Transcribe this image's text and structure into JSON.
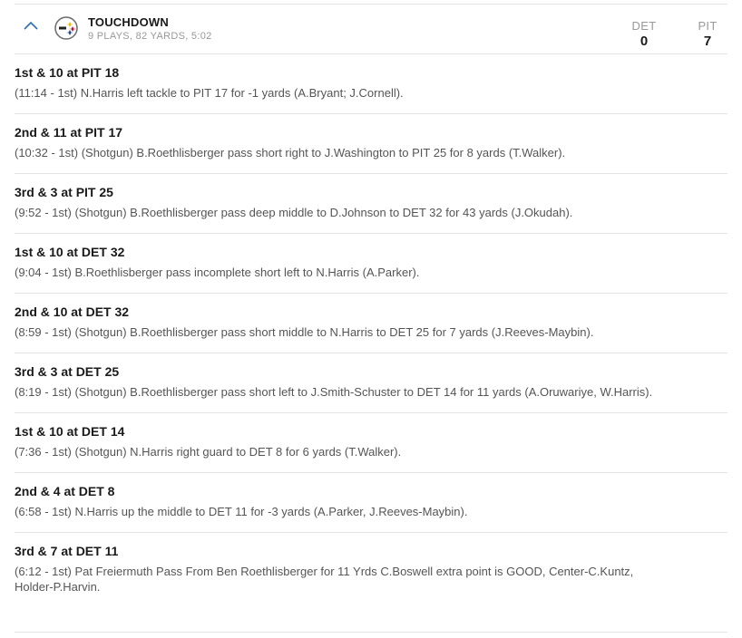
{
  "drive": {
    "result": "TOUCHDOWN",
    "summary": "9 PLAYS, 82 YARDS, 5:02",
    "scores": [
      {
        "team": "DET",
        "score": "0"
      },
      {
        "team": "PIT",
        "score": "7"
      }
    ],
    "colors": {
      "accent": "#2a6fb0",
      "logo_yellow": "#f5b400",
      "logo_red": "#c8102e",
      "logo_blue": "#1f3c88"
    }
  },
  "plays": [
    {
      "title": "1st & 10 at PIT 18",
      "desc": "(11:14 - 1st) N.Harris left tackle to PIT 17 for -1 yards (A.Bryant; J.Cornell)."
    },
    {
      "title": "2nd & 11 at PIT 17",
      "desc": "(10:32 - 1st) (Shotgun) B.Roethlisberger pass short right to J.Washington to PIT 25 for 8 yards (T.Walker)."
    },
    {
      "title": "3rd & 3 at PIT 25",
      "desc": "(9:52 - 1st) (Shotgun) B.Roethlisberger pass deep middle to D.Johnson to DET 32 for 43 yards (J.Okudah)."
    },
    {
      "title": "1st & 10 at DET 32",
      "desc": "(9:04 - 1st) B.Roethlisberger pass incomplete short left to N.Harris (A.Parker)."
    },
    {
      "title": "2nd & 10 at DET 32",
      "desc": "(8:59 - 1st) (Shotgun) B.Roethlisberger pass short middle to N.Harris to DET 25 for 7 yards (J.Reeves-Maybin)."
    },
    {
      "title": "3rd & 3 at DET 25",
      "desc": "(8:19 - 1st) (Shotgun) B.Roethlisberger pass short left to J.Smith-Schuster to DET 14 for 11 yards (A.Oruwariye, W.Harris)."
    },
    {
      "title": "1st & 10 at DET 14",
      "desc": "(7:36 - 1st) (Shotgun) N.Harris right guard to DET 8 for 6 yards (T.Walker)."
    },
    {
      "title": "2nd & 4 at DET 8",
      "desc": "(6:58 - 1st) N.Harris up the middle to DET 11 for -3 yards (A.Parker, J.Reeves-Maybin)."
    },
    {
      "title": "3rd & 7 at DET 11",
      "desc": "(6:12 - 1st) Pat Freiermuth Pass From Ben Roethlisberger for 11 Yrds C.Boswell extra point is GOOD, Center-C.Kuntz, Holder-P.Harvin."
    }
  ]
}
